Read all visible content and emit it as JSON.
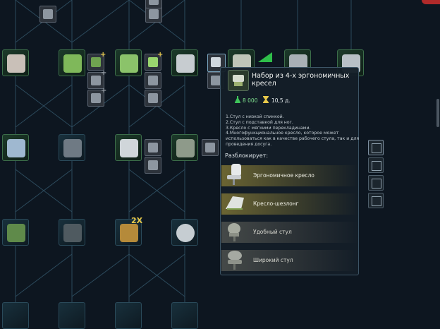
{
  "popup": {
    "title": "Набор из 4-х эргономичных кресел",
    "research_cost": "8 000",
    "time": "10,5 д.",
    "description": [
      "1.Стул с низкой спинкой.",
      "2.Стул с подставкой для ног.",
      "3.Кресло с мягкими перекладинами.",
      "4.Многофункциональное кресло, которое может",
      "использоваться как в качестве рабочего стула, так и для",
      "проведения досуга."
    ],
    "unlocks_label": "Разблокирует:",
    "unlocks": [
      {
        "label": "Эргономичное кресло",
        "icon": "ergonomic-chair-icon"
      },
      {
        "label": "Кресло-шезлонг",
        "icon": "lounge-chair-icon"
      },
      {
        "label": "Удобный стул",
        "icon": "comfy-chair-icon"
      },
      {
        "label": "Широкий стул",
        "icon": "wide-chair-icon"
      }
    ]
  },
  "badges": {
    "multiplier": "2X",
    "plus": "+"
  },
  "colors": {
    "accent": "#e7c84a",
    "node_border": "#3c6e4a",
    "research": "#3ec45a",
    "background": "#0d1620"
  }
}
